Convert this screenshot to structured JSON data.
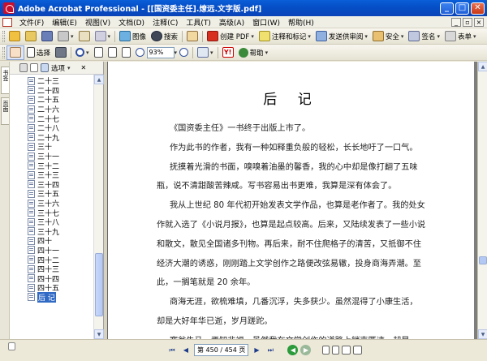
{
  "window": {
    "title": "Adobe Acrobat Professional - [[国资委主任].燎远.文字版.pdf]",
    "buttons": [
      "_",
      "□",
      "✕"
    ]
  },
  "menubar": {
    "items": [
      "文件(F)",
      "编辑(E)",
      "视图(V)",
      "文档(D)",
      "注释(C)",
      "工具(T)",
      "高级(A)",
      "窗口(W)",
      "帮助(H)"
    ]
  },
  "toolbar1": {
    "picture_task": "图像",
    "search": "搜索",
    "create_pdf": "创建 PDF",
    "comment": "注释和标记",
    "send_review": "发送供审阅",
    "secure": "安全",
    "sign": "签名",
    "forms": "表单"
  },
  "toolbar2": {
    "select": "选择",
    "zoom_value": "93%",
    "help": "帮助"
  },
  "left_tabs": [
    "书签",
    "页面"
  ],
  "bookmarks": {
    "options_label": "选项",
    "items": [
      "二十三",
      "二十四",
      "二十五",
      "二十六",
      "二十七",
      "二十八",
      "二十九",
      "三十",
      "三十一",
      "三十二",
      "三十三",
      "三十四",
      "三十五",
      "三十六",
      "三十七",
      "三十八",
      "三十九",
      "四十",
      "四十一",
      "四十二",
      "四十三",
      "四十四",
      "四十五",
      "后 记"
    ],
    "selected_index": 23
  },
  "document": {
    "heading": "后 记",
    "lines": [
      {
        "text": "《国资委主任》一书终于出版上市了。",
        "indent": true
      },
      {
        "text": "作为此书的作者，我有一种如释重负般的轻松，长长地吁了一口气。",
        "indent": true
      },
      {
        "text": "抚摸着光滑的书面，嗅嗅着油墨的馨香，我的心中却是像打翻了五味",
        "indent": true
      },
      {
        "text": "瓶，说不清甜酸苦辣咸。写书容易出书更难，我算是深有体会了。",
        "indent": false
      },
      {
        "text": "我从上世纪 80 年代初开始发表文学作品，也算是老作者了。我的处女",
        "indent": true
      },
      {
        "text": "作就入选了《小说月报》，也算是起点较高。后来，又陆续发表了一些小说",
        "indent": false
      },
      {
        "text": "和散文，散见全国诸多刊物。再后来，耐不住爬格子的清苦，又抵御不住",
        "indent": false
      },
      {
        "text": "经济大潮的诱惑，刚刚踏上文学创作之路便改弦易辙，投身商海弄潮。至",
        "indent": false
      },
      {
        "text": "此，一搁笔就是 20 余年。",
        "indent": false
      },
      {
        "text": "商海无涯，欲梳难填，几番沉浮，失多获少。虽然混得了小康生活，",
        "indent": true
      },
      {
        "text": "却是大好年华已逝，岁月蹉跎。",
        "indent": false
      },
      {
        "text": "塞翁失马，焉知非福。虽然我在文学创作的道路上销声匿迹，却是一",
        "indent": true
      }
    ]
  },
  "status": {
    "page_indicator": "第 450 / 454 页"
  },
  "colors": {
    "titlebar": "#0550c8",
    "selection": "#316ac5",
    "doc_background": "#7e7e7e"
  }
}
